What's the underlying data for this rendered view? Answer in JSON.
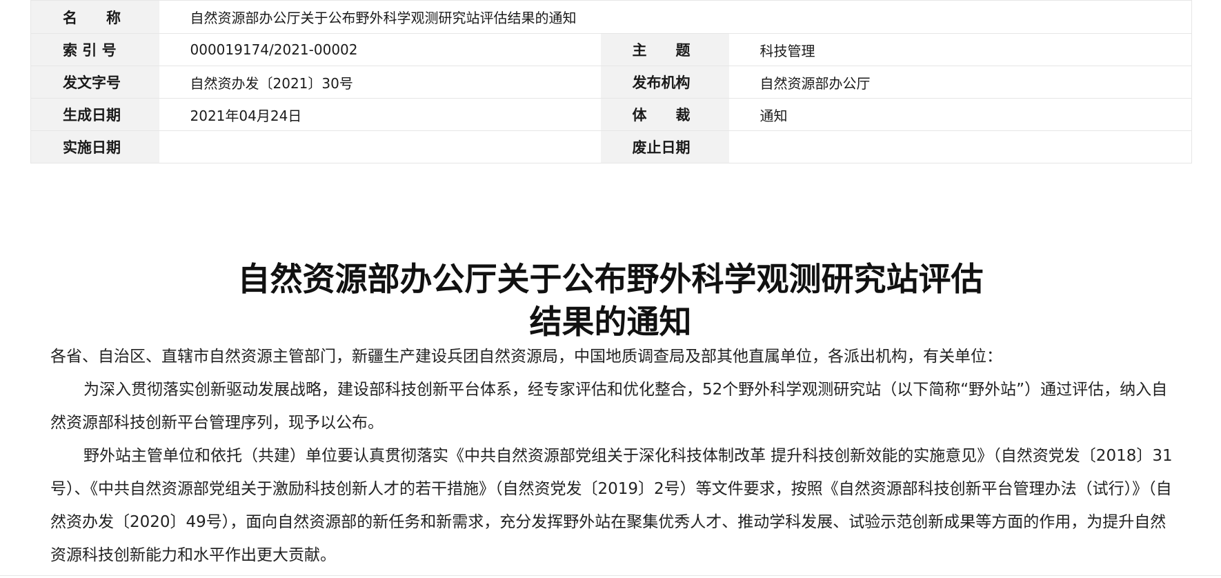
{
  "meta": {
    "rows": [
      {
        "label1": "名　　称",
        "value1": "自然资源部办公厅关于公布野外科学观测研究站评估结果的通知"
      },
      {
        "label1": "索 引 号",
        "value1": "000019174/2021-00002",
        "label2": "主　　题",
        "value2": "科技管理"
      },
      {
        "label1": "发文字号",
        "value1": "自然资办发〔2021〕30号",
        "label2": "发布机构",
        "value2": "自然资源部办公厅"
      },
      {
        "label1": "生成日期",
        "value1": "2021年04月24日",
        "label2": "体　　裁",
        "value2": "通知"
      },
      {
        "label1": "实施日期",
        "value1": "",
        "label2": "废止日期",
        "value2": ""
      }
    ]
  },
  "title": {
    "line1": "自然资源部办公厅关于公布野外科学观测研究站评估",
    "line2": "结果的通知"
  },
  "body": {
    "salutation": "各省、自治区、直辖市自然资源主管部门，新疆生产建设兵团自然资源局，中国地质调查局及部其他直属单位，各派出机构，有关单位：",
    "para1": "为深入贯彻落实创新驱动发展战略，建设部科技创新平台体系，经专家评估和优化整合，52个野外科学观测研究站（以下简称“野外站”）通过评估，纳入自然资源部科技创新平台管理序列，现予以公布。",
    "para2": "野外站主管单位和依托（共建）单位要认真贯彻落实《中共自然资源部党组关于深化科技体制改革 提升科技创新效能的实施意见》（自然资党发〔2018〕31号）、《中共自然资源部党组关于激励科技创新人才的若干措施》（自然资党发〔2019〕2号）等文件要求，按照《自然资源部科技创新平台管理办法（试行）》（自然资办发〔2020〕49号），面向自然资源部的新任务和新需求，充分发挥野外站在聚集优秀人才、推动学科发展、试验示范创新成果等方面的作用，为提升自然资源科技创新能力和水平作出更大贡献。"
  }
}
